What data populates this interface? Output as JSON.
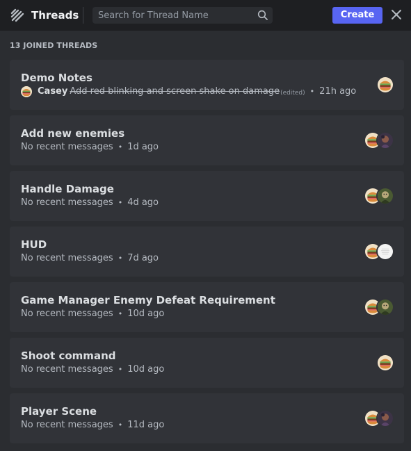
{
  "header": {
    "title": "Threads",
    "search_placeholder": "Search for Thread Name",
    "create_label": "Create"
  },
  "count_label": "13 JOINED THREADS",
  "threads": [
    {
      "title": "Demo Notes",
      "author": "Casey",
      "message": "Add red blinking and screen shake on damage",
      "edited": "(edited)",
      "time": "21h ago",
      "avatars": [
        "burger-avatar"
      ]
    },
    {
      "title": "Add new enemies",
      "status": "No recent messages",
      "time": "1d ago",
      "avatars": [
        "burger-avatar",
        "dark-avatar"
      ]
    },
    {
      "title": "Handle Damage",
      "status": "No recent messages",
      "time": "4d ago",
      "avatars": [
        "burger-avatar",
        "green-avatar"
      ]
    },
    {
      "title": "HUD",
      "status": "No recent messages",
      "time": "7d ago",
      "avatars": [
        "burger-avatar",
        "white-avatar"
      ]
    },
    {
      "title": "Game Manager Enemy Defeat Requirement",
      "status": "No recent messages",
      "time": "10d ago",
      "avatars": [
        "burger-avatar",
        "green-avatar"
      ]
    },
    {
      "title": "Shoot command",
      "status": "No recent messages",
      "time": "10d ago",
      "avatars": [
        "burger-avatar"
      ]
    },
    {
      "title": "Player Scene",
      "status": "No recent messages",
      "time": "11d ago",
      "avatars": [
        "burger-avatar",
        "dark-avatar"
      ]
    }
  ],
  "colors": {
    "background": "#2b2d31",
    "header": "#1e1f22",
    "card": "#313338",
    "accent": "#5865f2"
  }
}
